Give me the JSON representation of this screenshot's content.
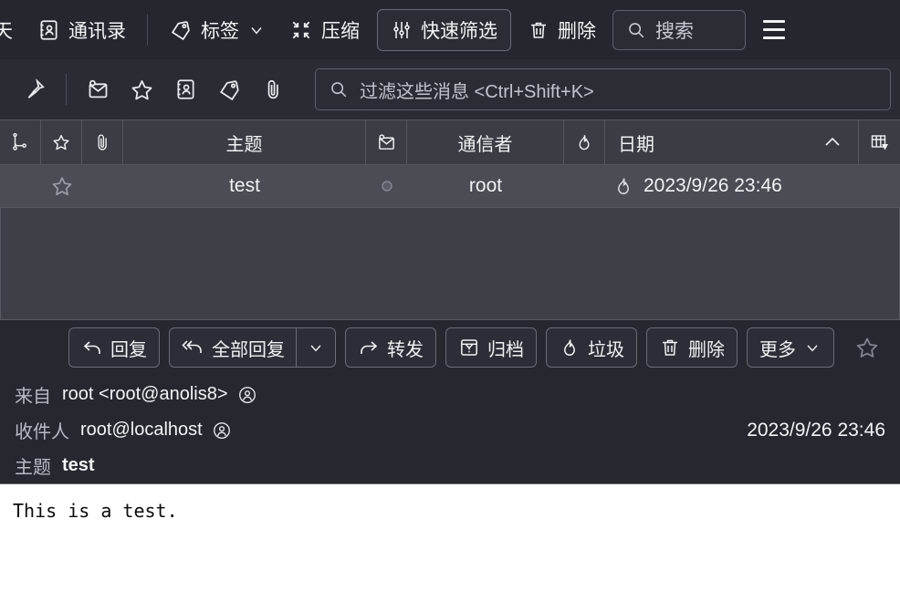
{
  "top_toolbar": {
    "tabs": [
      {
        "label": "聊天",
        "icon": "chat-icon",
        "clipped": true
      },
      {
        "label": "通讯录",
        "icon": "address-book-icon",
        "clipped": false
      }
    ],
    "tag_button": {
      "label": "标签",
      "icon": "tag-icon",
      "caret": "chevron-down-icon"
    },
    "compress_button": {
      "label": "压缩",
      "icon": "compress-icon"
    },
    "quick_filter_button": {
      "label": "快速筛选",
      "icon": "sliders-icon"
    },
    "delete_button": {
      "label": "删除",
      "icon": "trash-icon"
    },
    "search_box": {
      "label": "搜索",
      "icon": "search-icon"
    },
    "menu_button": {
      "icon": "hamburger-icon"
    }
  },
  "filter_toolbar": {
    "icons": [
      "pin-icon",
      "unread-envelope-icon",
      "star-icon",
      "contact-card-icon",
      "tag-icon",
      "paperclip-icon"
    ],
    "filter_input": {
      "placeholder": "过滤这些消息 <Ctrl+Shift+K>",
      "value": "",
      "icon": "search-icon"
    }
  },
  "message_list": {
    "columns": [
      {
        "key": "thread",
        "label": "",
        "icon": "thread-icon"
      },
      {
        "key": "starred",
        "label": "",
        "icon": "star-icon"
      },
      {
        "key": "attachment",
        "label": "",
        "icon": "paperclip-icon"
      },
      {
        "key": "subject",
        "label": "主题",
        "icon": ""
      },
      {
        "key": "unread",
        "label": "",
        "icon": "unread-envelope-icon"
      },
      {
        "key": "correspondent",
        "label": "通信者",
        "icon": ""
      },
      {
        "key": "junk",
        "label": "",
        "icon": "flame-icon"
      },
      {
        "key": "date",
        "label": "日期",
        "icon": "",
        "sort": "ascending",
        "sort_icon": "chevron-up-icon"
      },
      {
        "key": "picker",
        "label": "",
        "icon": "column-picker-icon"
      }
    ],
    "rows": [
      {
        "starred": false,
        "subject": "test",
        "read_state": "read-dot-icon",
        "correspondent": "root",
        "junk": "flame-icon",
        "date": "2023/9/26 23:46",
        "selected": true
      }
    ]
  },
  "message_pane": {
    "actions": [
      {
        "name": "reply",
        "label": "回复",
        "icon": "reply-icon",
        "has_caret": false
      },
      {
        "name": "reply-all",
        "label": "全部回复",
        "icon": "reply-all-icon",
        "has_caret": true
      },
      {
        "name": "forward",
        "label": "转发",
        "icon": "forward-icon",
        "has_caret": false
      },
      {
        "name": "archive",
        "label": "归档",
        "icon": "archive-icon",
        "has_caret": false
      },
      {
        "name": "junk",
        "label": "垃圾",
        "icon": "flame-icon",
        "has_caret": false
      },
      {
        "name": "delete",
        "label": "删除",
        "icon": "trash-icon",
        "has_caret": false
      },
      {
        "name": "more",
        "label": "更多",
        "icon": "",
        "has_caret": true
      }
    ],
    "star_button": {
      "icon": "star-icon"
    },
    "headers": {
      "from_label": "来自",
      "from_value": "root <root@anolis8>",
      "to_label": "收件人",
      "to_value": "root@localhost",
      "subject_label": "主题",
      "subject_value": "test",
      "date": "2023/9/26 23:46",
      "contact_icon": "contact-circle-icon"
    },
    "body": "This is a test."
  },
  "colors": {
    "window_bg": "#22232a",
    "toolbar_bg": "#25262e",
    "filter_bar_bg": "#2a2b33",
    "col_header_bg": "#3b3c44",
    "list_bg": "#3f4047",
    "row_selected_bg": "#4b4c54",
    "pane_bg": "#26272f",
    "body_bg": "#ffffff",
    "text": "#f4f4f7",
    "muted_text": "#b9bac3",
    "border": "#6a6b75"
  }
}
